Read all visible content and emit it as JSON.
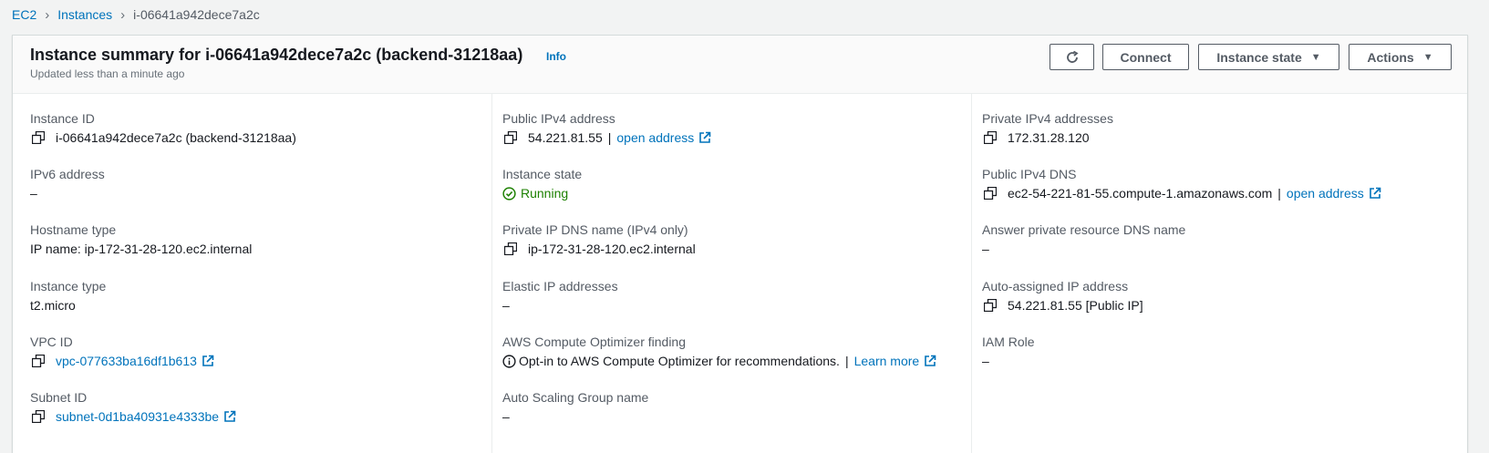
{
  "breadcrumb": {
    "items": [
      "EC2",
      "Instances"
    ],
    "current": "i-06641a942dece7a2c"
  },
  "header": {
    "title": "Instance summary for i-06641a942dece7a2c (backend-31218aa)",
    "info": "Info",
    "subtitle": "Updated less than a minute ago",
    "buttons": {
      "connect": "Connect",
      "instance_state": "Instance state",
      "actions": "Actions"
    }
  },
  "colors": {
    "link": "#0073bb",
    "running": "#1d8102",
    "label": "#545b64"
  },
  "fields": {
    "instance_id": {
      "label": "Instance ID",
      "value": "i-06641a942dece7a2c (backend-31218aa)"
    },
    "ipv6": {
      "label": "IPv6 address",
      "value": "–"
    },
    "hostname_type": {
      "label": "Hostname type",
      "value": "IP name: ip-172-31-28-120.ec2.internal"
    },
    "instance_type": {
      "label": "Instance type",
      "value": "t2.micro"
    },
    "vpc_id": {
      "label": "VPC ID",
      "value": "vpc-077633ba16df1b613"
    },
    "subnet_id": {
      "label": "Subnet ID",
      "value": "subnet-0d1ba40931e4333be"
    },
    "public_ipv4": {
      "label": "Public IPv4 address",
      "value": "54.221.81.55",
      "link": "open address"
    },
    "instance_state": {
      "label": "Instance state",
      "value": "Running"
    },
    "private_dns": {
      "label": "Private IP DNS name (IPv4 only)",
      "value": "ip-172-31-28-120.ec2.internal"
    },
    "elastic_ip": {
      "label": "Elastic IP addresses",
      "value": "–"
    },
    "optimizer": {
      "label": "AWS Compute Optimizer finding",
      "value": "Opt-in to AWS Compute Optimizer for recommendations.",
      "link": "Learn more"
    },
    "asg_name": {
      "label": "Auto Scaling Group name",
      "value": "–"
    },
    "private_ipv4": {
      "label": "Private IPv4 addresses",
      "value": "172.31.28.120"
    },
    "public_dns": {
      "label": "Public IPv4 DNS",
      "value": "ec2-54-221-81-55.compute-1.amazonaws.com",
      "link": "open address"
    },
    "answer_dns": {
      "label": "Answer private resource DNS name",
      "value": "–"
    },
    "auto_ip": {
      "label": "Auto-assigned IP address",
      "value": "54.221.81.55 [Public IP]"
    },
    "iam_role": {
      "label": "IAM Role",
      "value": "–"
    }
  }
}
